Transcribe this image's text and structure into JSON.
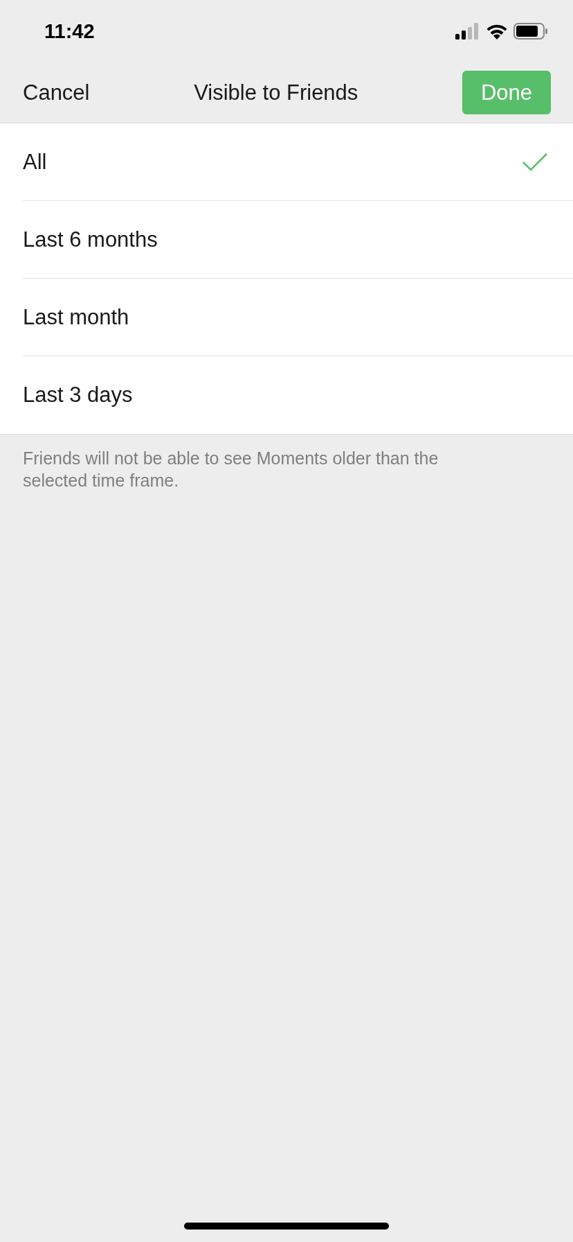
{
  "status_bar": {
    "time": "11:42"
  },
  "nav_bar": {
    "cancel": "Cancel",
    "title": "Visible to Friends",
    "done": "Done"
  },
  "options": [
    {
      "label": "All",
      "selected": true
    },
    {
      "label": "Last 6 months",
      "selected": false
    },
    {
      "label": "Last month",
      "selected": false
    },
    {
      "label": "Last 3 days",
      "selected": false
    }
  ],
  "footer_note": "Friends will not be able to see Moments older than the selected time frame."
}
